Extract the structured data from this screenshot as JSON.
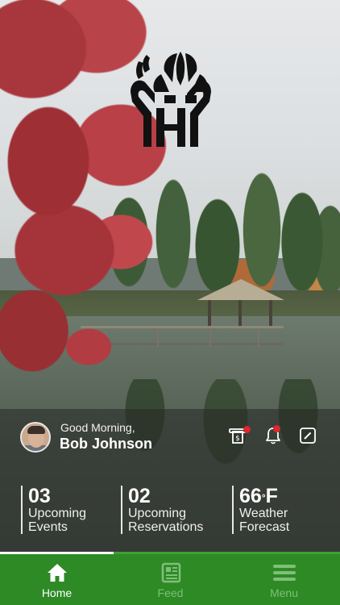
{
  "greeting": {
    "salutation": "Good Morning,",
    "user_name": "Bob Johnson"
  },
  "header_icons": {
    "billing": "billing-icon",
    "notifications": "bell-icon",
    "edit": "edit-icon",
    "billing_has_alert": true,
    "notifications_has_alert": true
  },
  "stats": [
    {
      "value": "03",
      "label_line1": "Upcoming",
      "label_line2": "Events"
    },
    {
      "value": "02",
      "label_line1": "Upcoming",
      "label_line2": "Reservations"
    },
    {
      "value": "66",
      "unit": "F",
      "label_line1": "Weather",
      "label_line2": "Forecast"
    }
  ],
  "nav": {
    "items": [
      {
        "label": "Home",
        "icon": "home-icon",
        "active": true
      },
      {
        "label": "Feed",
        "icon": "feed-icon",
        "active": false
      },
      {
        "label": "Menu",
        "icon": "menu-icon",
        "active": false
      }
    ]
  },
  "colors": {
    "nav_background": "#2d8a25",
    "alert_dot": "#e0262e",
    "nav_inactive": "#7fbf78"
  }
}
